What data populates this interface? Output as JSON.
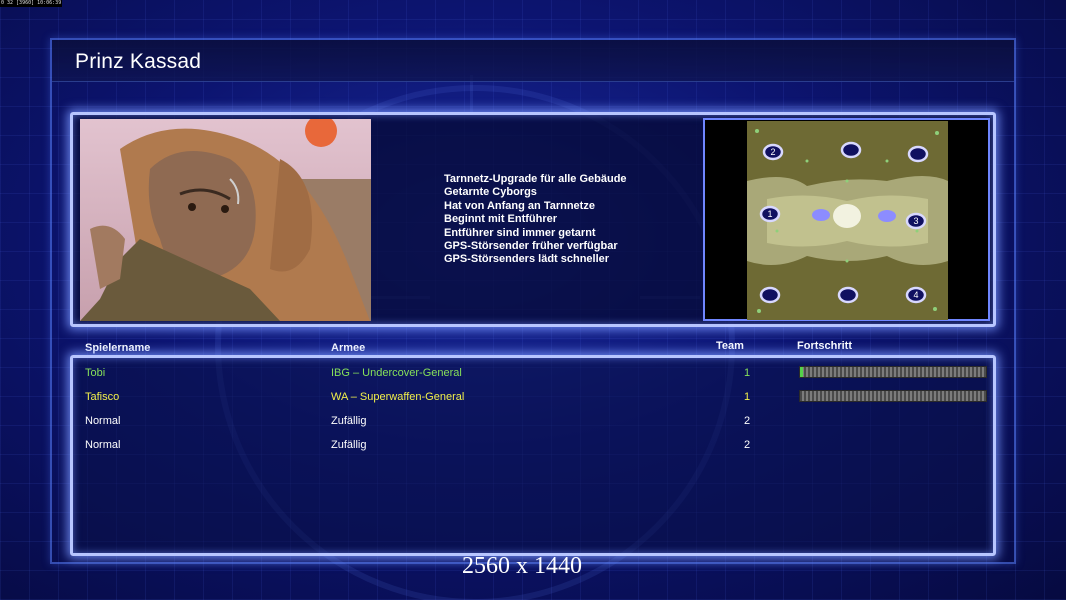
{
  "debug": {
    "text": "0 32 [3960] 10:06:39"
  },
  "title": "Prinz Kassad",
  "portrait": {
    "description_icon": "general-portrait-image"
  },
  "traits": [
    "Tarnnetz-Upgrade für alle Gebäude",
    "Getarnte Cyborgs",
    "Hat von Anfang an Tarnnetze",
    "Beginnt mit Entführer",
    "Entführer sind immer getarnt",
    "GPS-Störsender früher verfügbar",
    "GPS-Störsenders lädt schneller"
  ],
  "map": {
    "start_positions": [
      "1",
      "2",
      "3",
      "4"
    ]
  },
  "columns": {
    "player": "Spielername",
    "army": "Armee",
    "team": "Team",
    "progress": "Fortschritt"
  },
  "players": [
    {
      "name": "Tobi",
      "army": "IBG – Undercover-General",
      "team": "1",
      "color": "#86e05a",
      "progress": 0.015
    },
    {
      "name": "Tafisco",
      "army": "WA – Superwaffen-General",
      "team": "1",
      "color": "#f2f04a",
      "progress": 0.0
    },
    {
      "name": "Normal",
      "army": "Zufällig",
      "team": "2",
      "color": "#ffffff"
    },
    {
      "name": "Normal",
      "army": "Zufällig",
      "team": "2",
      "color": "#ffffff"
    }
  ],
  "resolution_label": "2560 x 1440",
  "colors": {
    "accent": "#b8c6ff",
    "background": "#0c1470"
  }
}
